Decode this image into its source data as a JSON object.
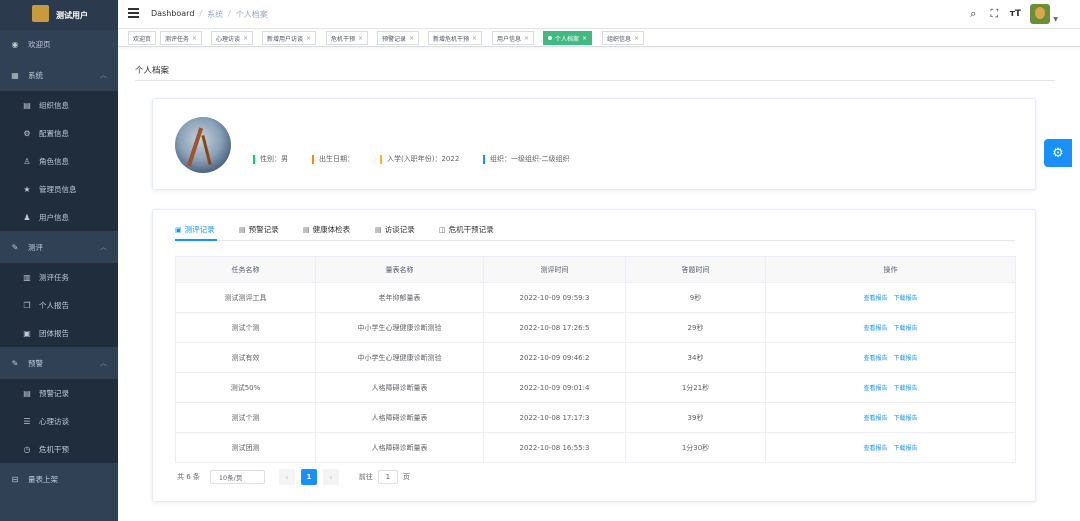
{
  "app": {
    "user_name": "测试用户"
  },
  "sidebar": {
    "items": [
      {
        "label": "欢迎页",
        "icon": "dashboard-icon"
      },
      {
        "label": "系统",
        "icon": "grid-icon"
      },
      {
        "label": "组织信息",
        "icon": "document-icon"
      },
      {
        "label": "配置信息",
        "icon": "settings-icon"
      },
      {
        "label": "角色信息",
        "icon": "user-outline-icon"
      },
      {
        "label": "管理员信息",
        "icon": "star-icon"
      },
      {
        "label": "用户信息",
        "icon": "user-icon"
      },
      {
        "label": "测评",
        "icon": "edit-icon"
      },
      {
        "label": "测评任务",
        "icon": "book-icon"
      },
      {
        "label": "个人报告",
        "icon": "copy-icon"
      },
      {
        "label": "团体报告",
        "icon": "file-icon"
      },
      {
        "label": "预警",
        "icon": "edit-icon"
      },
      {
        "label": "预警记录",
        "icon": "list-icon"
      },
      {
        "label": "心理访谈",
        "icon": "sliders-icon"
      },
      {
        "label": "危机干预",
        "icon": "clock-icon"
      },
      {
        "label": "量表上架",
        "icon": "inbox-icon"
      }
    ]
  },
  "breadcrumb": {
    "home": "Dashboard",
    "system": "系统",
    "current": "个人档案"
  },
  "tags": [
    {
      "label": "欢迎页"
    },
    {
      "label": "测评任务"
    },
    {
      "label": "心理访谈"
    },
    {
      "label": "新增用户访谈"
    },
    {
      "label": "危机干预"
    },
    {
      "label": "预警记录"
    },
    {
      "label": "新增危机干预"
    },
    {
      "label": "用户信息"
    },
    {
      "label": "个人档案"
    },
    {
      "label": "组织信息"
    }
  ],
  "page": {
    "title": "个人档案"
  },
  "profile": {
    "gender": "性别：男",
    "birth": "出生日期：",
    "enroll": "入学(入职年份)：2022",
    "org": "组织：一级组织-二级组织"
  },
  "colors": {
    "gender": "#13ce66",
    "birth": "#ff8c00",
    "enroll": "#ffba00",
    "org": "#1890ff",
    "accent": "#1890ff"
  },
  "tabs": [
    {
      "label": "测评记录",
      "icon": "calendar-icon"
    },
    {
      "label": "预警记录",
      "icon": "document-icon"
    },
    {
      "label": "健康体检表",
      "icon": "document-icon"
    },
    {
      "label": "访谈记录",
      "icon": "document-icon"
    },
    {
      "label": "危机干预记录",
      "icon": "book-icon"
    }
  ],
  "table": {
    "headers": [
      "任务名称",
      "量表名称",
      "测评时间",
      "答题时间",
      "操作"
    ],
    "rows": [
      {
        "task": "测试测评工具",
        "scale": "老年抑郁量表",
        "time": "2022-10-09 09:59:3",
        "duration": "9秒"
      },
      {
        "task": "测试个测",
        "scale": "中小学生心理健康诊断测验",
        "time": "2022-10-08 17:26:5",
        "duration": "29秒"
      },
      {
        "task": "测试有效",
        "scale": "中小学生心理健康诊断测验",
        "time": "2022-10-09 09:46:2",
        "duration": "34秒"
      },
      {
        "task": "测试50%",
        "scale": "人格障碍诊断量表",
        "time": "2022-10-09 09:01:4",
        "duration": "1分21秒"
      },
      {
        "task": "测试个测",
        "scale": "人格障碍诊断量表",
        "time": "2022-10-08 17:17:3",
        "duration": "39秒"
      },
      {
        "task": "测试团测",
        "scale": "人格障碍诊断量表",
        "time": "2022-10-08 16:55:3",
        "duration": "1分30秒"
      }
    ],
    "actions": {
      "view": "查看报告",
      "download": "下载报告"
    }
  },
  "pagination": {
    "total": "共 6 条",
    "page_size": "10条/页",
    "prev": "‹",
    "next": "›",
    "current": "1",
    "goto_label": "前往",
    "goto_value": "1",
    "unit": "页"
  }
}
